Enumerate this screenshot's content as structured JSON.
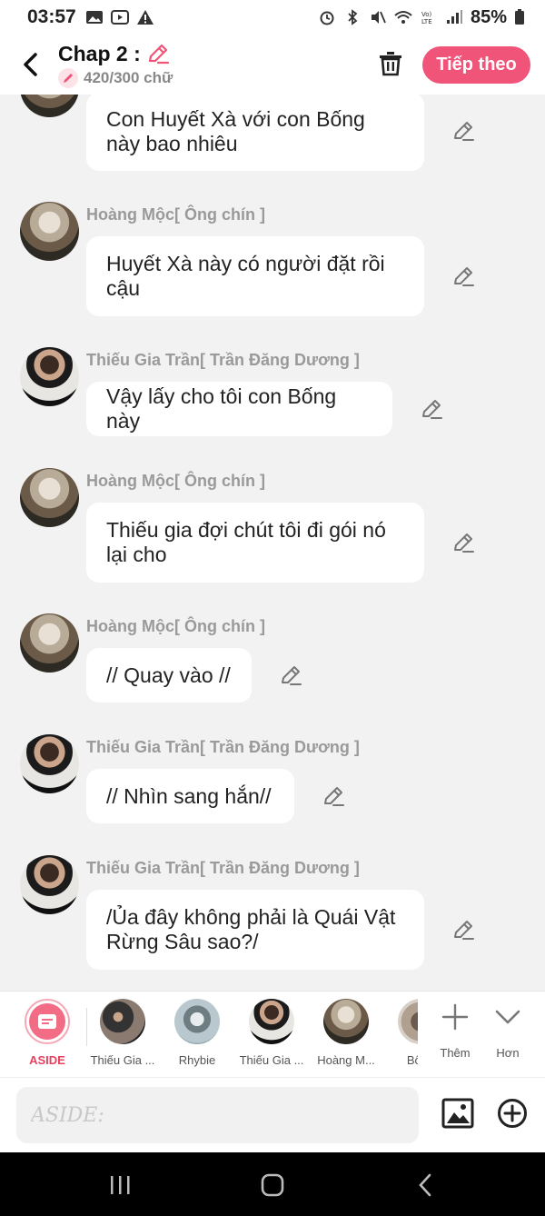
{
  "status_bar": {
    "time": "03:57",
    "battery": "85%"
  },
  "header": {
    "title": "Chap 2 :",
    "count": "420/300 chữ",
    "next_label": "Tiếp theo"
  },
  "messages": [
    {
      "speaker": "",
      "text": "Con Huyết Xà với con Bống này bao nhiêu",
      "avatar": "old-man"
    },
    {
      "speaker": "Hoàng Mộc[ Ông chín ]",
      "text": "Huyết Xà này có người đặt rồi cậu",
      "avatar": "old-man"
    },
    {
      "speaker": "Thiếu Gia Trần[ Trần Đăng Dương ]",
      "text": "Vậy lấy cho tôi con Bống này",
      "avatar": "young-man"
    },
    {
      "speaker": "Hoàng Mộc[ Ông chín ]",
      "text": "Thiếu gia đợi chút tôi đi gói nó lại cho",
      "avatar": "old-man"
    },
    {
      "speaker": "Hoàng Mộc[ Ông chín ]",
      "text": "// Quay vào //",
      "avatar": "old-man"
    },
    {
      "speaker": "Thiếu Gia Trần[ Trần Đăng Dương ]",
      "text": "// Nhìn sang hắn//",
      "avatar": "young-man"
    },
    {
      "speaker": "Thiếu Gia Trần[ Trần Đăng Dương ]",
      "text": "/Ủa đây không phải là Quái Vật Rừng Sâu sao?/",
      "avatar": "young-man"
    }
  ],
  "characters": [
    {
      "name": "ASIDE"
    },
    {
      "name": "Thiếu Gia ..."
    },
    {
      "name": "Rhybie"
    },
    {
      "name": "Thiếu Gia ..."
    },
    {
      "name": "Hoàng M..."
    },
    {
      "name": "Bống"
    }
  ],
  "tools": {
    "add_label": "Thêm",
    "more_label": "Hơn"
  },
  "input": {
    "placeholder": "ASIDE:"
  },
  "colors": {
    "accent": "#f05478",
    "background": "#f2f2f2"
  }
}
